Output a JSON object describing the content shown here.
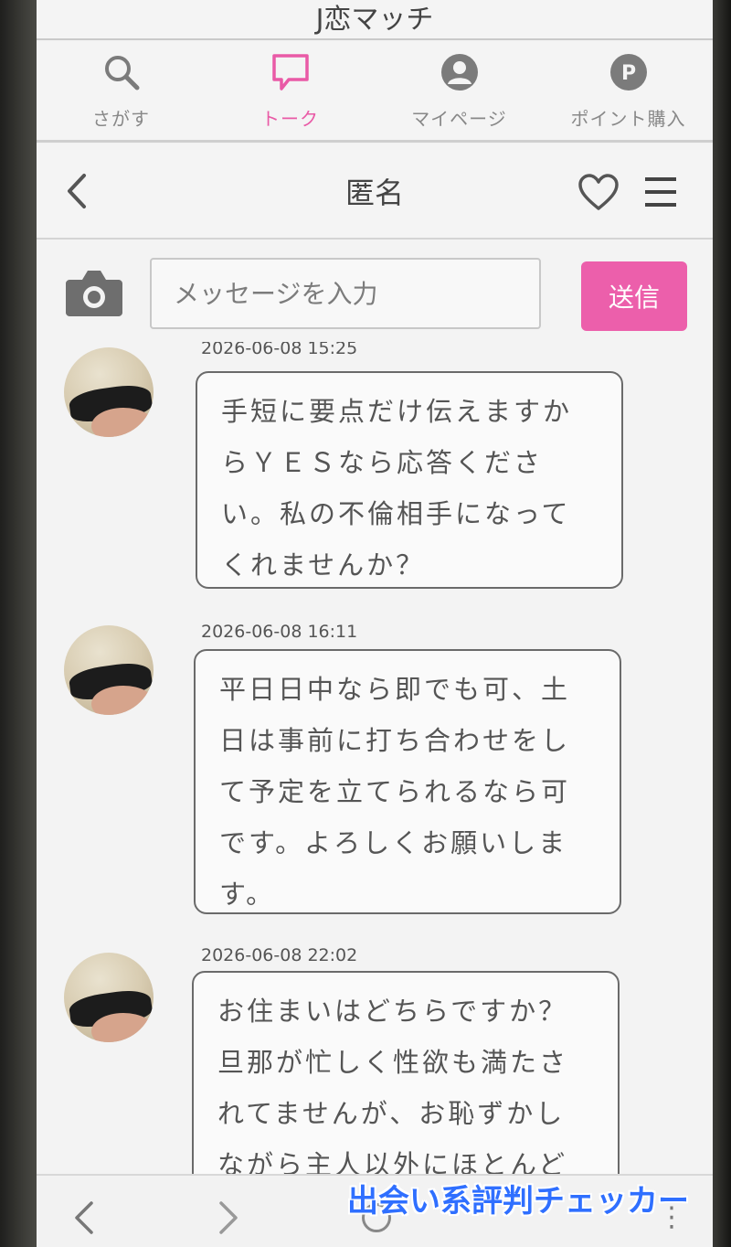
{
  "app": {
    "title": "J恋マッチ"
  },
  "nav": {
    "items": [
      {
        "label": "さがす",
        "icon": "search-icon",
        "active": false
      },
      {
        "label": "トーク",
        "icon": "chat-bubble-icon",
        "active": true
      },
      {
        "label": "マイページ",
        "icon": "user-icon",
        "active": false
      },
      {
        "label": "ポイント購入",
        "icon": "points-icon",
        "active": false
      }
    ],
    "active_color": "#e95aa6"
  },
  "chat": {
    "partner_name": "匿名",
    "input_placeholder": "メッセージを入力",
    "send_label": "送信",
    "send_color": "#ec5fab"
  },
  "messages": [
    {
      "timestamp": "2026-06-08 15:25",
      "lines": [
        "手短に要点だけ伝えますか",
        "らＹＥＳなら応答くださ",
        "い。私の不倫相手になって",
        "くれませんか？"
      ]
    },
    {
      "timestamp": "2026-06-08 16:11",
      "lines": [
        "平日日中なら即でも可、土",
        "日は事前に打ち合わせをし",
        "て予定を立てられるなら可",
        "です。よろしくお願いしま",
        "す。"
      ]
    },
    {
      "timestamp": "2026-06-08 22:02",
      "lines": [
        "お住まいはどちらですか？",
        "旦那が忙しく性欲も満たさ",
        "れてませんが、お恥ずかし",
        "ながら主人以外にほとんど"
      ]
    }
  ],
  "watermark": "出会い系評判チェッカー"
}
